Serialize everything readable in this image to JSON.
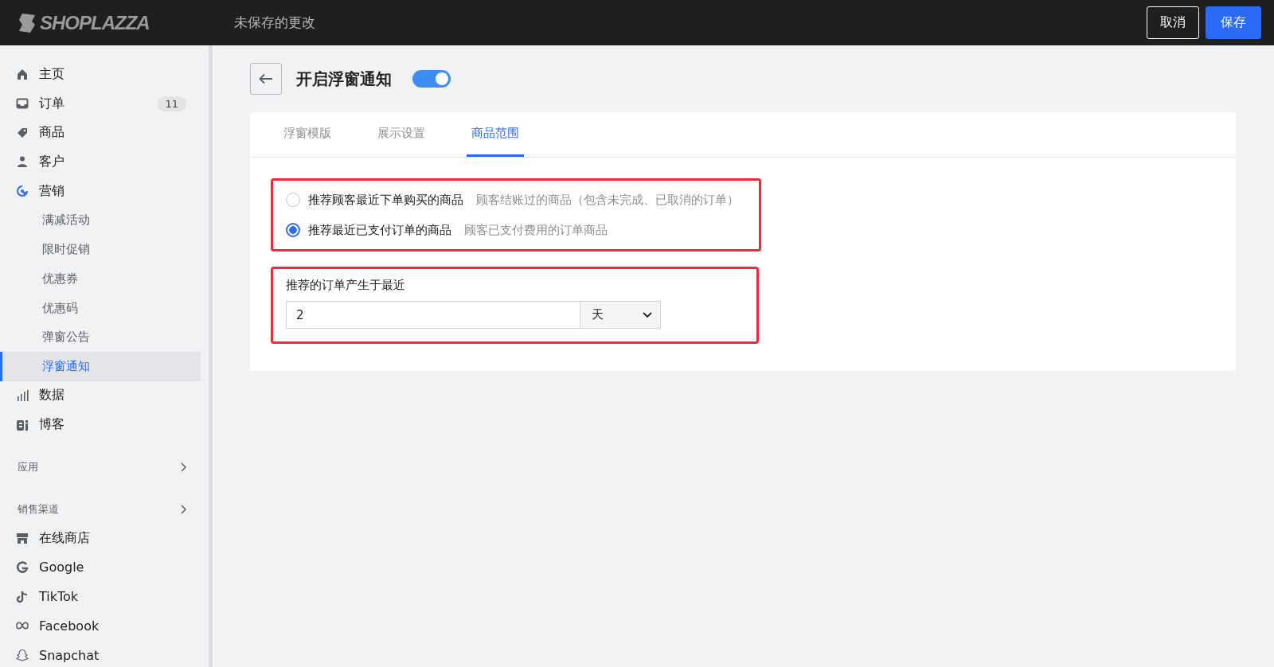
{
  "top_bar": {
    "logo": "SHOPLAZZA",
    "status": "未保存的更改",
    "buttons": [
      {
        "label": "取消",
        "kind": "secondary"
      },
      {
        "label": "保存",
        "kind": "primary"
      }
    ]
  },
  "sidebar": {
    "items": [
      {
        "label": "主页",
        "selected": false
      },
      {
        "label": "订单",
        "selected": false,
        "badge": "11"
      },
      {
        "label": "商品",
        "selected": false
      },
      {
        "label": "客户",
        "selected": false
      },
      {
        "label": "营销",
        "selected": true,
        "children": [
          {
            "label": "满减活动",
            "selected": false
          },
          {
            "label": "限时促销",
            "selected": false
          },
          {
            "label": "优惠券",
            "selected": false
          },
          {
            "label": "优惠码",
            "selected": false
          },
          {
            "label": "弹窗公告",
            "selected": false
          },
          {
            "label": "浮窗通知",
            "selected": true
          }
        ]
      },
      {
        "label": "数据",
        "selected": false
      },
      {
        "label": "博客",
        "selected": false
      }
    ],
    "sections": [
      {
        "label": "应用"
      },
      {
        "label": "销售渠道",
        "items": [
          {
            "label": "在线商店",
            "selected": false
          },
          {
            "label": "Google",
            "selected": false
          },
          {
            "label": "TikTok",
            "selected": false
          },
          {
            "label": "Facebook",
            "selected": false
          },
          {
            "label": "Snapchat",
            "selected": false
          }
        ]
      }
    ]
  },
  "page": {
    "title": "开启浮窗通知",
    "enabled": {
      "on": true
    },
    "tabs": [
      {
        "label": "浮窗模版",
        "selected": false
      },
      {
        "label": "展示设置",
        "selected": false
      },
      {
        "label": "商品范围",
        "selected": true
      }
    ],
    "options": [
      {
        "label": "推荐顾客最近下单购买的商品",
        "hint": "顾客结账过的商品（包含未完成、已取消的订单）",
        "selected": false
      },
      {
        "label": "推荐最近已支付订单的商品",
        "hint": "顾客已支付费用的订单商品",
        "selected": true
      }
    ],
    "period": {
      "label": "推荐的订单产生于最近",
      "value": "2",
      "unit": "天"
    }
  }
}
